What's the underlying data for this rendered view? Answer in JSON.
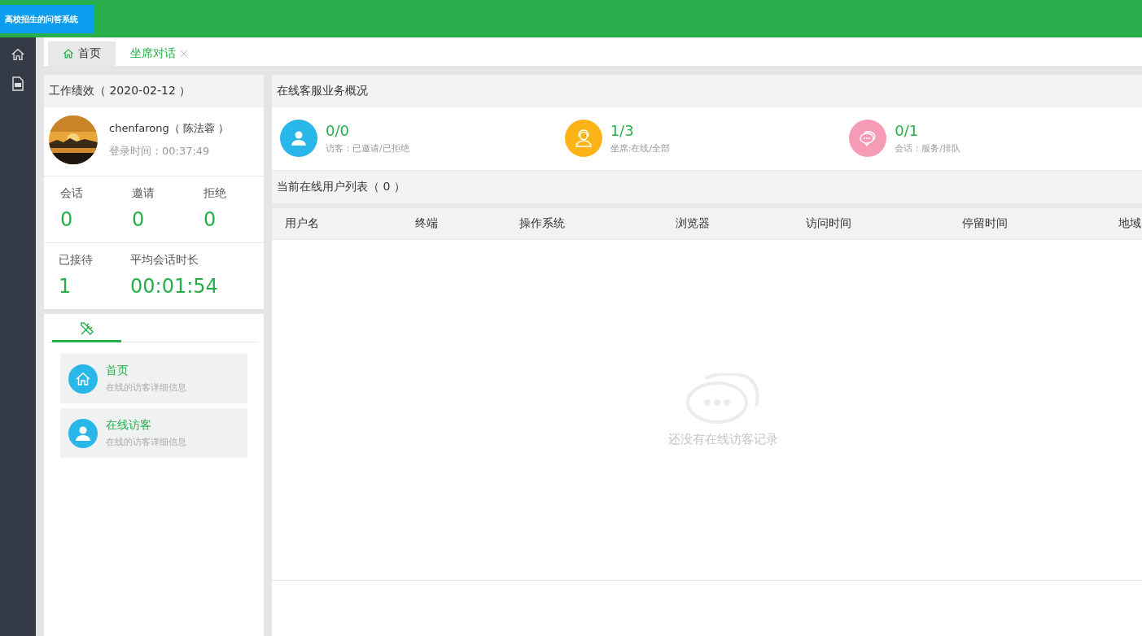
{
  "logo": "高校招生的问答系统",
  "side_icons": [
    {
      "kind": "home"
    },
    {
      "kind": "file"
    }
  ],
  "tabs": [
    {
      "label": "首页",
      "selected": true,
      "closable": false
    },
    {
      "label": "坐席对话",
      "selected": false,
      "closable": true
    }
  ],
  "performance": {
    "title": "工作绩效（ 2020-02-12 ）",
    "user": "chenfarong（ 陈法蓉 ）",
    "login": "登录时间：00:37:49",
    "stats": [
      {
        "label": "会话",
        "value": "0"
      },
      {
        "label": "邀请",
        "value": "0"
      },
      {
        "label": "拒绝",
        "value": "0"
      }
    ],
    "stats2": [
      {
        "label": "已接待",
        "value": "1"
      },
      {
        "label": "平均会话时长",
        "value": "00:01:54"
      }
    ]
  },
  "menu": {
    "items": [
      {
        "kind": "home",
        "title": "首页",
        "desc": "在线的访客详细信息"
      },
      {
        "kind": "user",
        "title": "在线访客",
        "desc": "在线的访客详细信息"
      }
    ]
  },
  "overview": {
    "title": "在线客服业务概况",
    "items": [
      {
        "kind": "user",
        "value": "0/0",
        "label": "访客：已邀请/已拒绝",
        "color": "#29b6e8"
      },
      {
        "kind": "agent",
        "value": "1/3",
        "label": "坐席:在线/全部",
        "color": "#fbb316"
      },
      {
        "kind": "chat",
        "value": "0/1",
        "label": "会话：服务/排队",
        "color": "#f59bb5"
      }
    ]
  },
  "online": {
    "title": "当前在线用户列表（ 0 ）",
    "columns": [
      "用户名",
      "终端",
      "操作系统",
      "浏览器",
      "访问时间",
      "停留时间",
      "地域"
    ],
    "empty": "还没有在线访客记录"
  }
}
